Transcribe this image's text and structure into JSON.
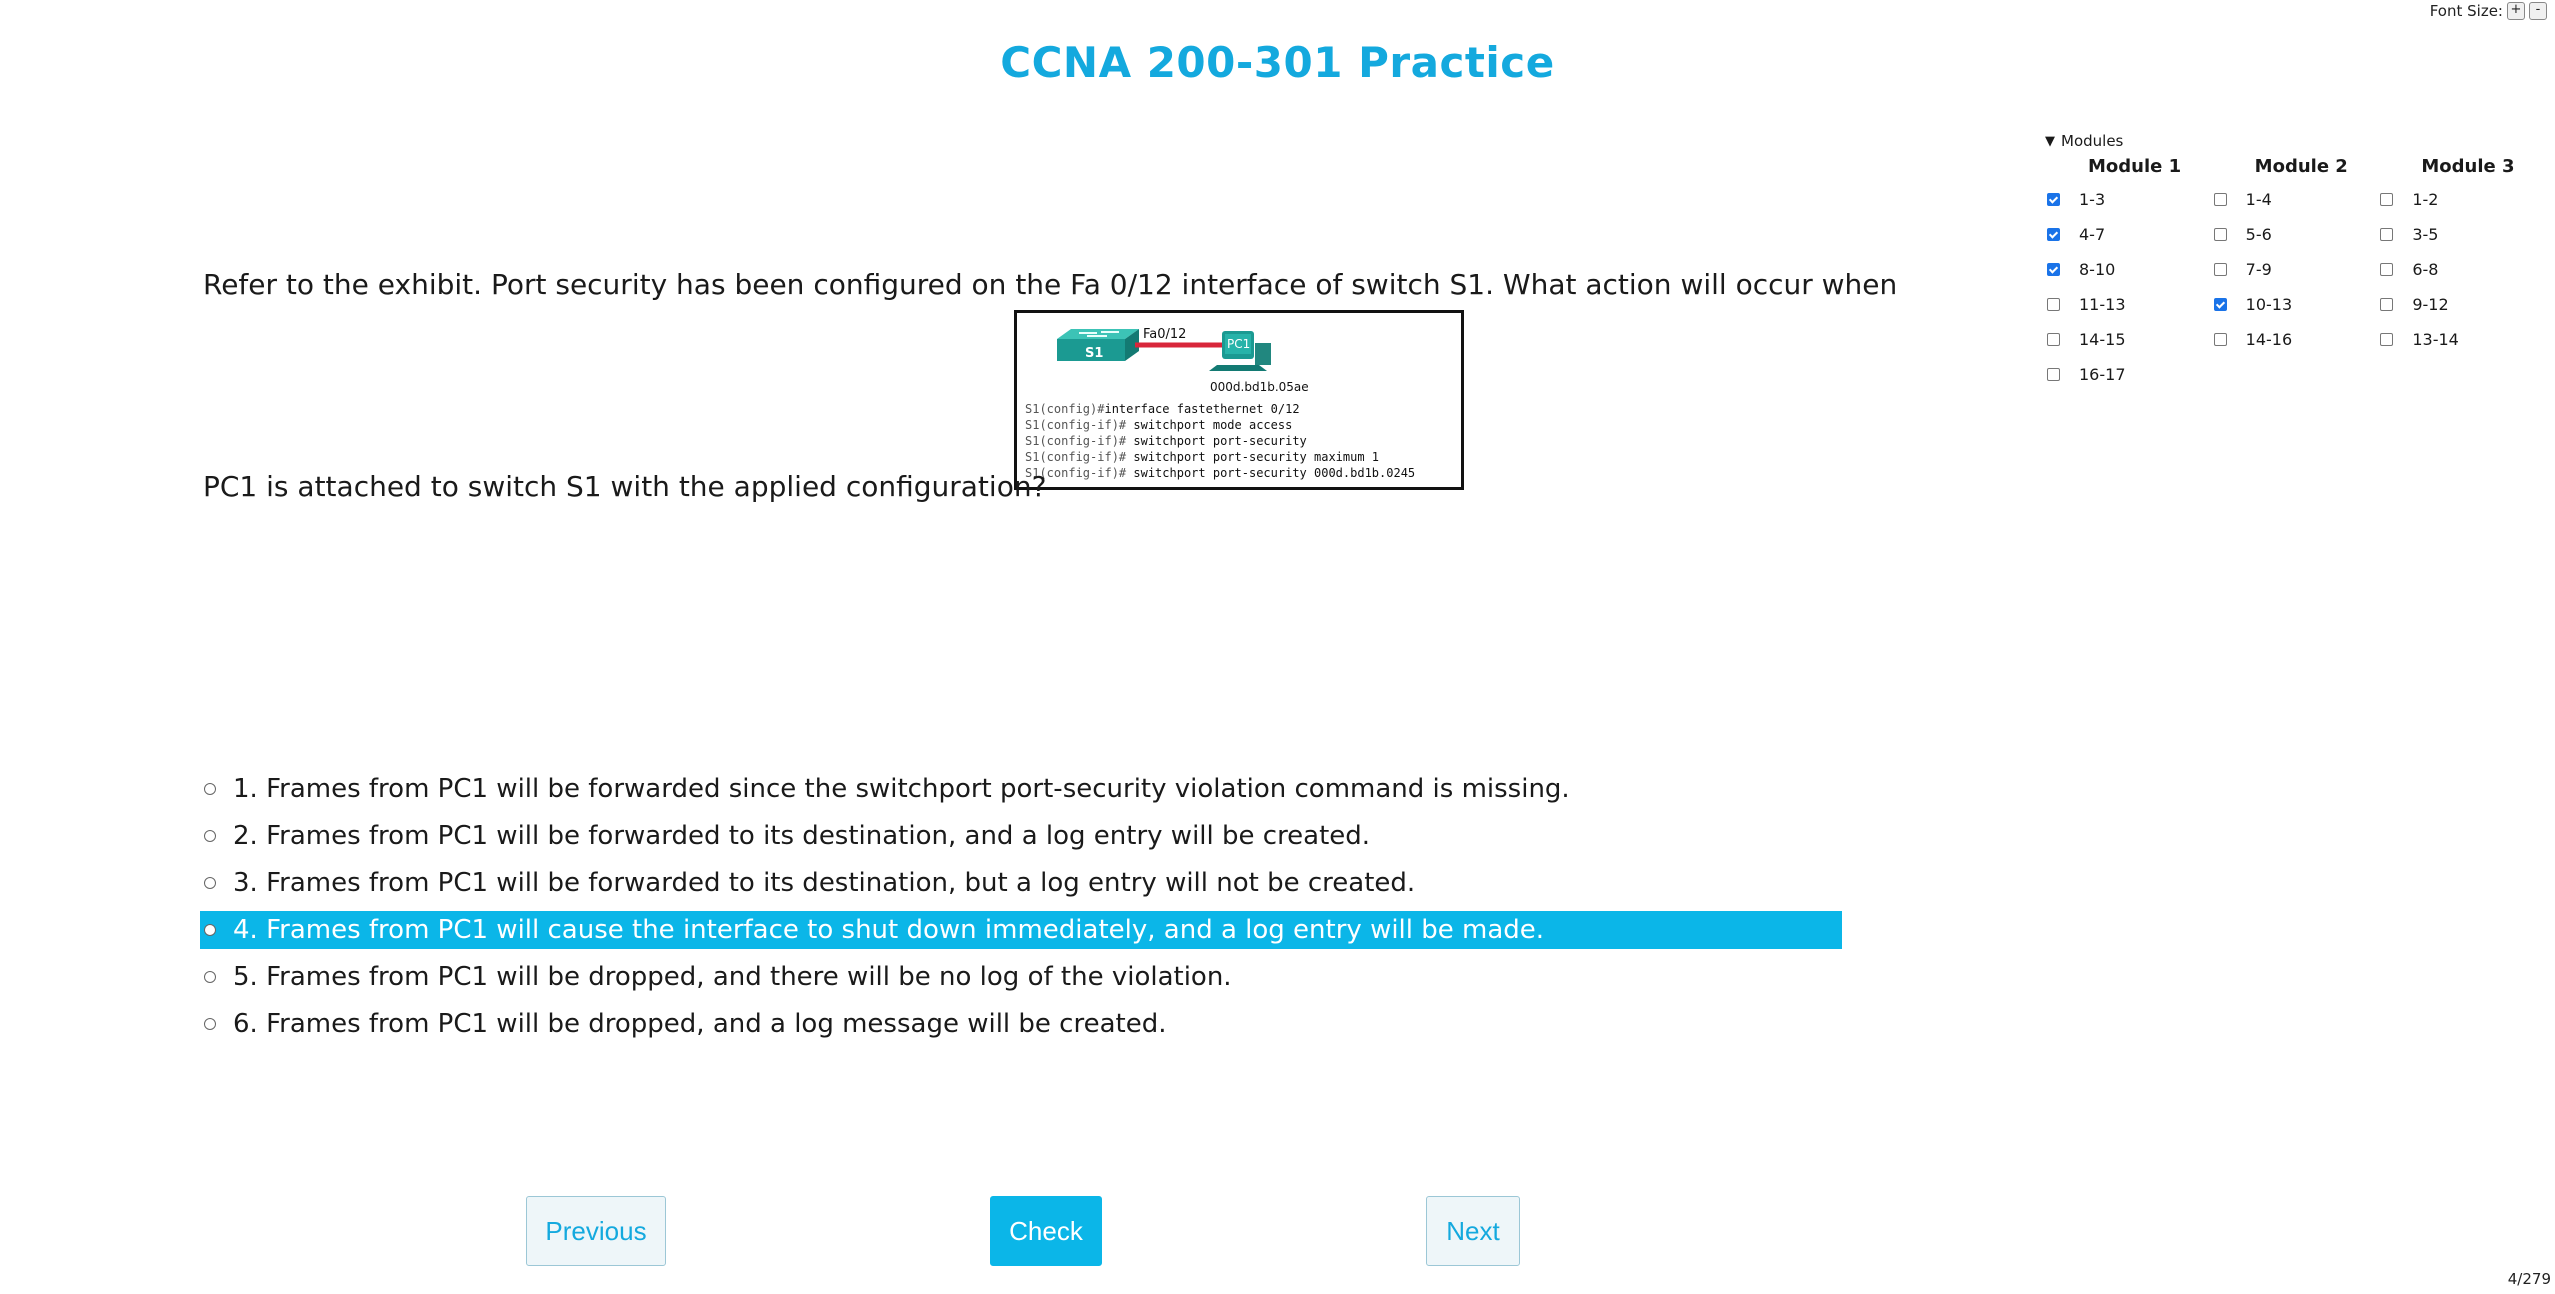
{
  "font_size_control": {
    "label": "Font Size:",
    "increase": "+",
    "decrease": "-"
  },
  "title": "CCNA 200-301 Practice",
  "modules": {
    "summary": "Modules",
    "columns": [
      {
        "heading": "Module 1",
        "items": [
          {
            "label": "1-3",
            "checked": true
          },
          {
            "label": "4-7",
            "checked": true
          },
          {
            "label": "8-10",
            "checked": true
          },
          {
            "label": "11-13",
            "checked": false
          },
          {
            "label": "14-15",
            "checked": false
          },
          {
            "label": "16-17",
            "checked": false
          }
        ]
      },
      {
        "heading": "Module 2",
        "items": [
          {
            "label": "1-4",
            "checked": false
          },
          {
            "label": "5-6",
            "checked": false
          },
          {
            "label": "7-9",
            "checked": false
          },
          {
            "label": "10-13",
            "checked": true
          },
          {
            "label": "14-16",
            "checked": false
          }
        ]
      },
      {
        "heading": "Module 3",
        "items": [
          {
            "label": "1-2",
            "checked": false
          },
          {
            "label": "3-5",
            "checked": false
          },
          {
            "label": "6-8",
            "checked": false
          },
          {
            "label": "9-12",
            "checked": false
          },
          {
            "label": "13-14",
            "checked": false
          }
        ]
      }
    ]
  },
  "question": {
    "line1": "Refer to the exhibit. Port security has been configured on the Fa 0/12 interface of switch S1. What action will occur when",
    "line2": "PC1 is attached to switch S1 with the applied configuration?"
  },
  "exhibit": {
    "switch_label": "S1",
    "port_label": "Fa0/12",
    "pc_label": "PC1",
    "mac_label": "000d.bd1b.05ae",
    "cli": [
      {
        "prompt": "S1(config)#",
        "command": "interface fastethernet 0/12"
      },
      {
        "prompt": "S1(config-if)#",
        "command": " switchport mode access"
      },
      {
        "prompt": "S1(config-if)#",
        "command": " switchport port-security"
      },
      {
        "prompt": "S1(config-if)#",
        "command": " switchport port-security maximum 1"
      },
      {
        "prompt": "S1(config-if)#",
        "command": " switchport port-security 000d.bd1b.0245"
      }
    ]
  },
  "options": [
    {
      "text": "1. Frames from PC1 will be forwarded since the switchport port-security violation command is missing.",
      "selected": false
    },
    {
      "text": "2. Frames from PC1 will be forwarded to its destination, and a log entry will be created.",
      "selected": false
    },
    {
      "text": "3. Frames from PC1 will be forwarded to its destination, but a log entry will not be created.",
      "selected": false
    },
    {
      "text": "4. Frames from PC1 will cause the interface to shut down immediately, and a log entry will be made.",
      "selected": true
    },
    {
      "text": "5. Frames from PC1 will be dropped, and there will be no log of the violation.",
      "selected": false
    },
    {
      "text": "6. Frames from PC1 will be dropped, and a log message will be created.",
      "selected": false
    }
  ],
  "buttons": {
    "previous": "Previous",
    "check": "Check",
    "next": "Next"
  },
  "page_counter": "4/279",
  "colors": {
    "accent": "#14a9de",
    "selected_bg": "#0bb6e8",
    "switch_teal": "#1b9a92",
    "link_red": "#d8263a"
  }
}
